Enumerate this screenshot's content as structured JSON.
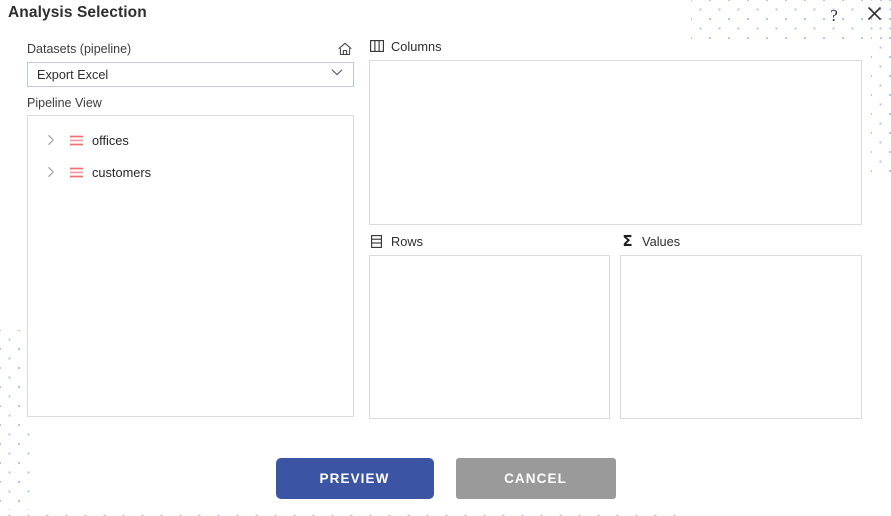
{
  "window": {
    "title": "Analysis Selection",
    "help_icon": "question-mark-icon",
    "help_label": "?",
    "close_icon": "close-icon",
    "close_label": "✕"
  },
  "left": {
    "datasets_label": "Datasets (pipeline)",
    "home_icon": "home-icon",
    "dataset_select": {
      "value": "Export Excel",
      "chevron_icon": "chevron-down-icon"
    },
    "pipeline_view_label": "Pipeline View",
    "tree_items": [
      {
        "label": "offices",
        "expand_icon": "chevron-right-icon",
        "type_icon": "list-lines-icon"
      },
      {
        "label": "customers",
        "expand_icon": "chevron-right-icon",
        "type_icon": "list-lines-icon"
      }
    ]
  },
  "panels": {
    "columns": {
      "label": "Columns",
      "icon": "columns-icon",
      "items": []
    },
    "rows": {
      "label": "Rows",
      "icon": "rows-icon",
      "items": []
    },
    "values": {
      "label": "Values",
      "icon": "sigma-icon",
      "glyph": "Σ",
      "items": []
    }
  },
  "footer": {
    "preview_label": "PREVIEW",
    "cancel_label": "CANCEL"
  },
  "colors": {
    "primary": "#3b55a4",
    "secondary": "#9a9a9a",
    "accent_tree_icon": "#f26d6d",
    "dot_pattern": "#b9c4ef",
    "panel_border": "#dcdcdc",
    "input_border": "#c3c9d6"
  }
}
